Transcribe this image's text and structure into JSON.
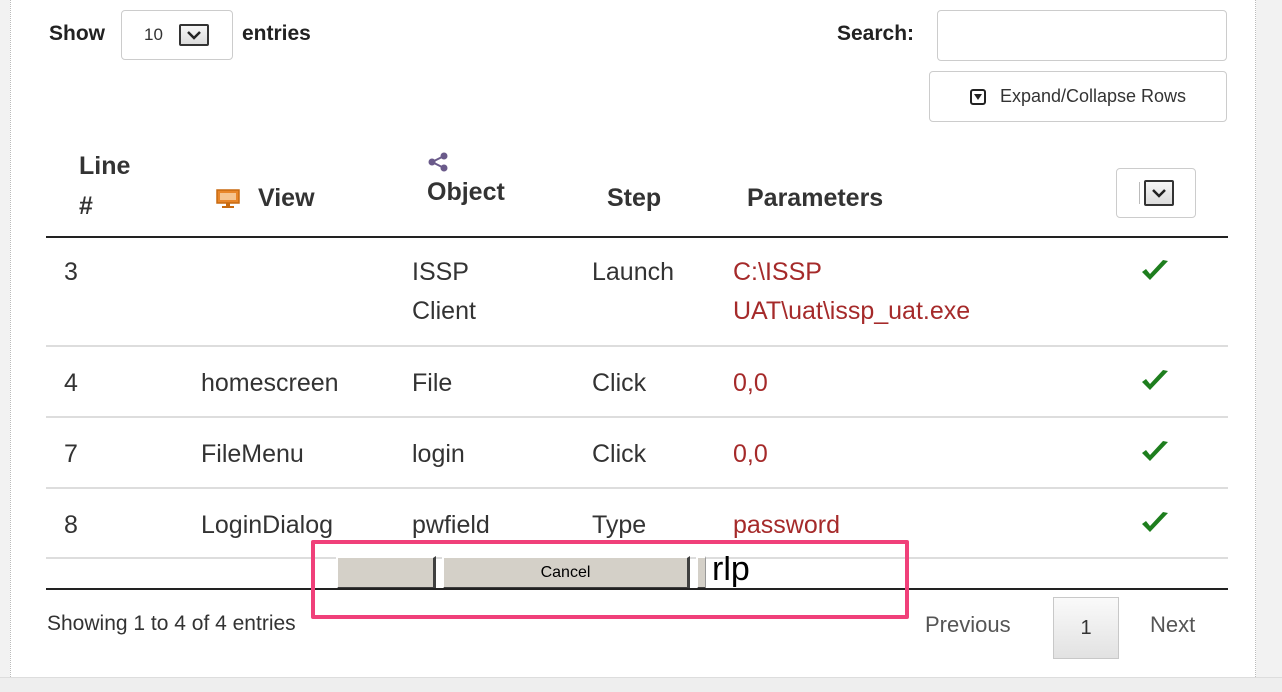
{
  "controls": {
    "show_label": "Show",
    "length_value": "10",
    "entries_label": "entries",
    "search_label": "Search:",
    "search_value": "",
    "expand_label": "Expand/Collapse Rows"
  },
  "table": {
    "headers": {
      "line_1": "Line",
      "line_2": "#",
      "view": "View",
      "object": "Object",
      "step": "Step",
      "parameters": "Parameters"
    },
    "rows": [
      {
        "line": "3",
        "view": "",
        "object_1": "ISSP",
        "object_2": "Client",
        "step": "Launch",
        "param_1": "C:\\ISSP",
        "param_2": "UAT\\uat\\issp_uat.exe",
        "status": "check"
      },
      {
        "line": "4",
        "view": "homescreen",
        "object_1": "File",
        "object_2": "",
        "step": "Click",
        "param_1": "0,0",
        "param_2": "",
        "status": "check"
      },
      {
        "line": "7",
        "view": "FileMenu",
        "object_1": "login",
        "object_2": "",
        "step": "Click",
        "param_1": "0,0",
        "param_2": "",
        "status": "check"
      },
      {
        "line": "8",
        "view": "LoginDialog",
        "object_1": "pwfield",
        "object_2": "",
        "step": "Type",
        "param_1": "password",
        "param_2": "",
        "status": "check"
      }
    ]
  },
  "overlay": {
    "cancel_label": "Cancel",
    "partial_text": "rlp"
  },
  "footer": {
    "info": "Showing 1 to 4 of 4 entries",
    "previous": "Previous",
    "page": "1",
    "next": "Next"
  },
  "colors": {
    "param_text": "#a52a2a",
    "check": "#1e7e1e",
    "highlight": "#f0407a",
    "monitor_icon": "#e8862a",
    "share_icon": "#6a5a8a"
  }
}
